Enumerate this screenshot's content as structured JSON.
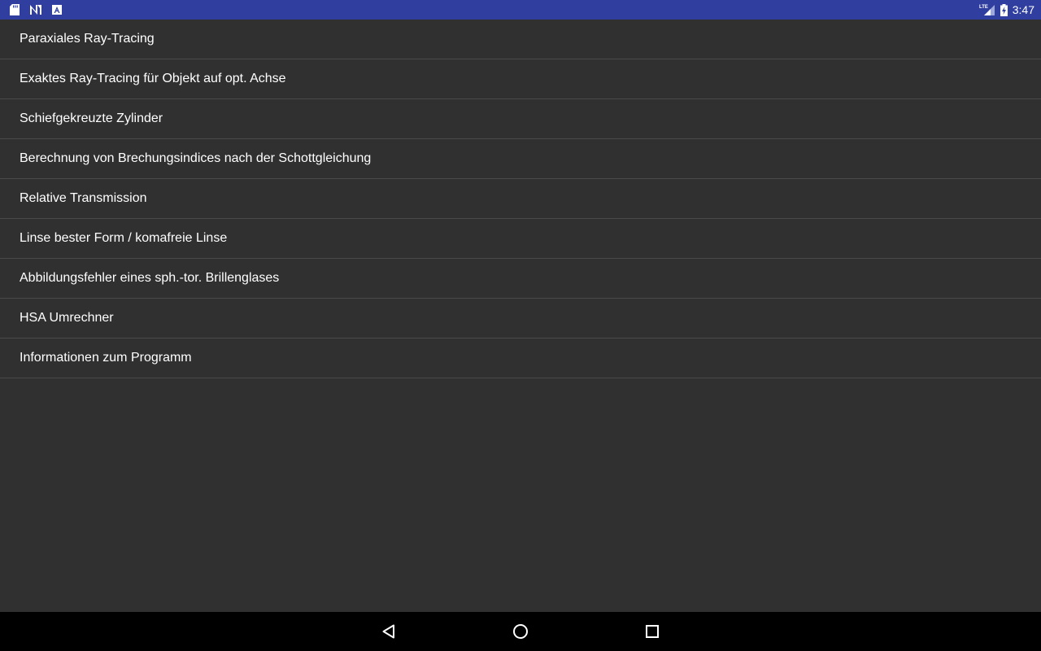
{
  "status_bar": {
    "time": "3:47",
    "background_color": "#303f9f",
    "left_icons": [
      "sd-card-icon",
      "n-notification-icon",
      "a-notification-icon"
    ],
    "right_icons": [
      "lte-signal-icon",
      "battery-charging-icon"
    ],
    "network_label": "LTE"
  },
  "menu": {
    "items": [
      {
        "label": "Paraxiales Ray-Tracing"
      },
      {
        "label": "Exaktes Ray-Tracing für Objekt auf opt. Achse"
      },
      {
        "label": "Schiefgekreuzte Zylinder"
      },
      {
        "label": "Berechnung von Brechungsindices nach der Schottgleichung"
      },
      {
        "label": "Relative Transmission"
      },
      {
        "label": "Linse bester Form / komafreie Linse"
      },
      {
        "label": "Abbildungsfehler eines sph.-tor. Brillenglases"
      },
      {
        "label": "HSA Umrechner"
      },
      {
        "label": "Informationen zum Programm"
      }
    ]
  },
  "nav_bar": {
    "buttons": [
      "back-icon",
      "home-icon",
      "recents-icon"
    ]
  },
  "colors": {
    "background": "#303030",
    "divider": "#4a4a4a",
    "text": "#ffffff",
    "nav_bar": "#000000"
  }
}
